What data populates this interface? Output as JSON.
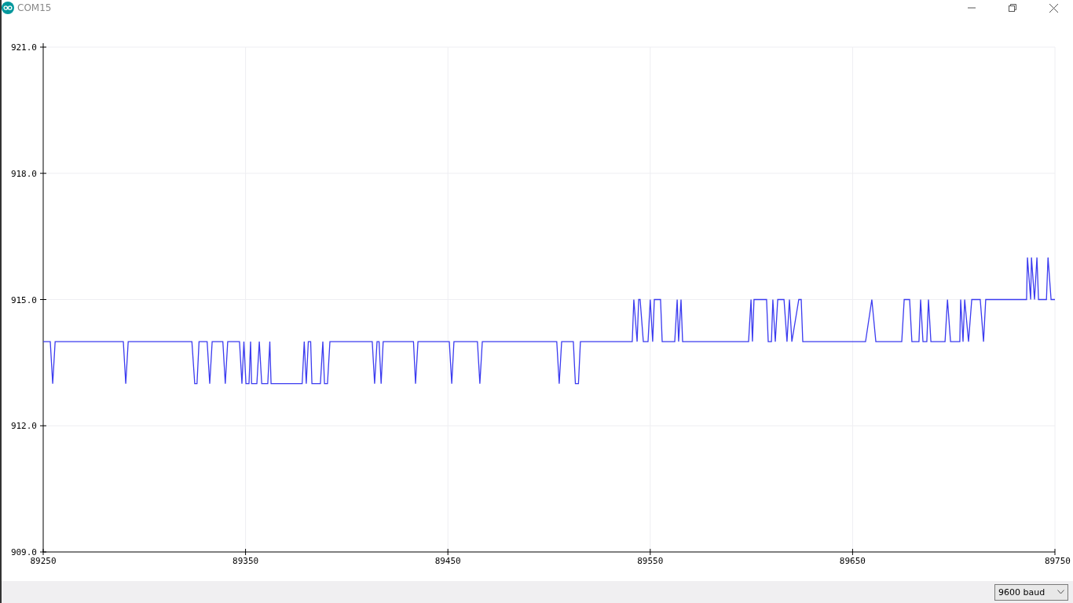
{
  "window": {
    "title": "COM15"
  },
  "plot": {
    "chart_data": {
      "type": "line",
      "x": [
        89250,
        89253.5,
        89254.7,
        89255.9,
        89289.6,
        89290.8,
        89292,
        89323.5,
        89324.9,
        89326,
        89327,
        89331,
        89332.3,
        89333.5,
        89338.8,
        89340,
        89341.2,
        89347,
        89348.2,
        89349.2,
        89350.2,
        89351.7,
        89352.5,
        89353,
        89355.6,
        89356.8,
        89358,
        89361,
        89362,
        89362.6,
        89378,
        89379,
        89380,
        89381,
        89382.2,
        89382.8,
        89387,
        89388.2,
        89389,
        89390.5,
        89391.7,
        89412.6,
        89413.8,
        89415,
        89416,
        89417,
        89418,
        89433,
        89434,
        89435.2,
        89450.7,
        89451.9,
        89453,
        89464.6,
        89465.8,
        89467,
        89503.8,
        89505,
        89506.2,
        89512,
        89513,
        89514.5,
        89515.5,
        89541.1,
        89541.9,
        89543.5,
        89544.3,
        89545,
        89546.6,
        89548.9,
        89550,
        89551.2,
        89552,
        89555.1,
        89555.9,
        89562.1,
        89563.3,
        89564,
        89565.2,
        89566,
        89598.6,
        89599.8,
        89600.5,
        89601.3,
        89607.5,
        89608.3,
        89609.9,
        89610.6,
        89611.8,
        89613,
        89616.1,
        89617.6,
        89618.8,
        89620,
        89623.4,
        89624.6,
        89625.4,
        89656.4,
        89659.5,
        89661.5,
        89674.3,
        89675.5,
        89678.2,
        89679.3,
        89682.8,
        89683.6,
        89684.8,
        89686.7,
        89687.5,
        89688.7,
        89695.7,
        89696.9,
        89698.4,
        89703,
        89703.4,
        89704.6,
        89705.4,
        89707.3,
        89708.9,
        89713.1,
        89714.7,
        89715.8,
        89736,
        89736.4,
        89738,
        89738.4,
        89739.9,
        89741.1,
        89741.9,
        89745.8,
        89746.6,
        89748.1,
        89750
      ],
      "grid": true,
      "series": [
        {
          "color": "#3b3bf0",
          "values": [
            914,
            914,
            913,
            914,
            914,
            913,
            914,
            914,
            913,
            913,
            914,
            914,
            913,
            914,
            914,
            913,
            914,
            914,
            913,
            914,
            913,
            913,
            914,
            913,
            913,
            914,
            913,
            913,
            914,
            913,
            913,
            914,
            913,
            914,
            914,
            913,
            913,
            914,
            913,
            913,
            914,
            914,
            913,
            914,
            914,
            913,
            914,
            914,
            913,
            914,
            914,
            913,
            914,
            914,
            913,
            914,
            914,
            913,
            914,
            914,
            913,
            913,
            914,
            914,
            915,
            914,
            915,
            915,
            914,
            914,
            915,
            914,
            915,
            915,
            914,
            914,
            915,
            914,
            915,
            914,
            914,
            915,
            914,
            915,
            915,
            914,
            914,
            915,
            914,
            915,
            915,
            914,
            915,
            914,
            915,
            915,
            914,
            914,
            915,
            914,
            914,
            915,
            915,
            914,
            914,
            915,
            914,
            914,
            915,
            914,
            914,
            915,
            914,
            914,
            915,
            914,
            915,
            914,
            915,
            915,
            914,
            915,
            915,
            916,
            915,
            916,
            915,
            916,
            915,
            915,
            916,
            915,
            915
          ]
        }
      ],
      "xlim": [
        89250,
        89750
      ],
      "ylim": [
        909,
        921
      ],
      "xticks": [
        89250,
        89350,
        89450,
        89550,
        89650,
        89750
      ],
      "yticks": [
        {
          "value": 909,
          "label": "909.0"
        },
        {
          "value": 912,
          "label": "912.0"
        },
        {
          "value": 915,
          "label": "915.0"
        },
        {
          "value": 918,
          "label": "918.0"
        },
        {
          "value": 921,
          "label": "921.0"
        }
      ]
    }
  },
  "footer": {
    "baud_select": {
      "value": "9600 baud"
    }
  }
}
